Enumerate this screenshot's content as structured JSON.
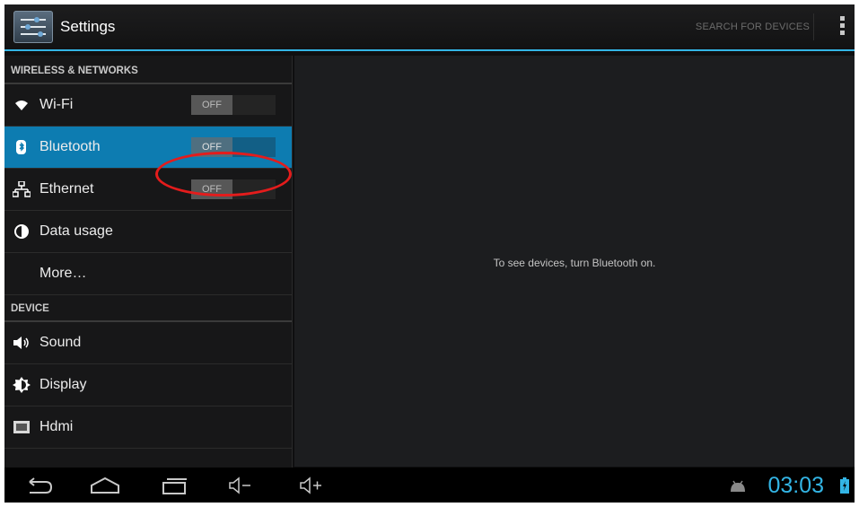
{
  "app": {
    "title": "Settings"
  },
  "action_bar": {
    "search_label": "SEARCH FOR DEVICES"
  },
  "sidebar": {
    "sections": [
      {
        "header": "WIRELESS & NETWORKS"
      },
      {
        "header": "DEVICE"
      }
    ],
    "items": [
      {
        "label": "Wi-Fi",
        "icon": "wifi-icon",
        "switch": "OFF"
      },
      {
        "label": "Bluetooth",
        "icon": "bluetooth-icon",
        "switch": "OFF",
        "selected": true
      },
      {
        "label": "Ethernet",
        "icon": "ethernet-icon",
        "switch": "OFF"
      },
      {
        "label": "Data usage",
        "icon": "data-usage-icon"
      },
      {
        "label": "More…"
      },
      {
        "label": "Sound",
        "icon": "speaker-icon"
      },
      {
        "label": "Display",
        "icon": "brightness-icon"
      },
      {
        "label": "Hdmi",
        "icon": "hdmi-icon"
      }
    ]
  },
  "content": {
    "message": "To see devices, turn Bluetooth on."
  },
  "system_bar": {
    "clock": "03:03"
  },
  "colors": {
    "accent": "#33b5e5",
    "selected": "#0d7cb1",
    "annotation": "#e41c1c"
  }
}
